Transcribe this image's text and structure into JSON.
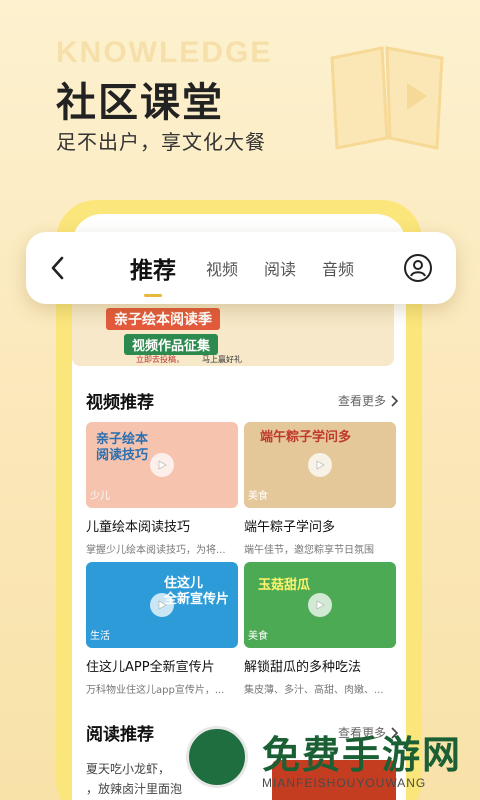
{
  "hero": {
    "watermark": "KNOWLEDGE",
    "title": "社区课堂",
    "subtitle": "足不出户，享文化大餐"
  },
  "nav": {
    "tabs": [
      {
        "label": "推荐",
        "active": true
      },
      {
        "label": "视频",
        "active": false
      },
      {
        "label": "阅读",
        "active": false
      },
      {
        "label": "音频",
        "active": false
      }
    ]
  },
  "banner": {
    "title": "亲子绘本阅读季",
    "subtitle": "视频作品征集",
    "tag": "立即去投稿，",
    "tag2": "马上赢好礼"
  },
  "video_section": {
    "title": "视频推荐",
    "more": "查看更多",
    "cards": [
      {
        "title": "儿童绘本阅读技巧",
        "desc": "掌握少儿绘本阅读技巧，为将...",
        "category": "少儿",
        "overlay": "亲子绘本\n阅读技巧",
        "color": "#f4b9a4"
      },
      {
        "title": "端午粽子学问多",
        "desc": "端午佳节，邀您粽享节日氛围",
        "category": "美食",
        "overlay": "端午粽子学问多",
        "color": "#d9b98a"
      },
      {
        "title": "住这儿APP全新宣传片",
        "desc": "万科物业住这儿app宣传片，...",
        "category": "生活",
        "overlay": "住这儿\n全新宣传片",
        "color": "#1f8fd0"
      },
      {
        "title": "解锁甜瓜的多种吃法",
        "desc": "集皮薄、多汁、高甜、肉嫩、...",
        "category": "美食",
        "overlay": "玉菇甜瓜",
        "color": "#3b9a4a"
      }
    ]
  },
  "read_section": {
    "title": "阅读推荐",
    "more": "查看更多",
    "items": [
      "夏天吃小龙虾，",
      "，放辣卤汁里面泡"
    ]
  },
  "watermark": {
    "title": "免费手游网",
    "subtitle": "MIANFEISHOUYOUWANG"
  }
}
